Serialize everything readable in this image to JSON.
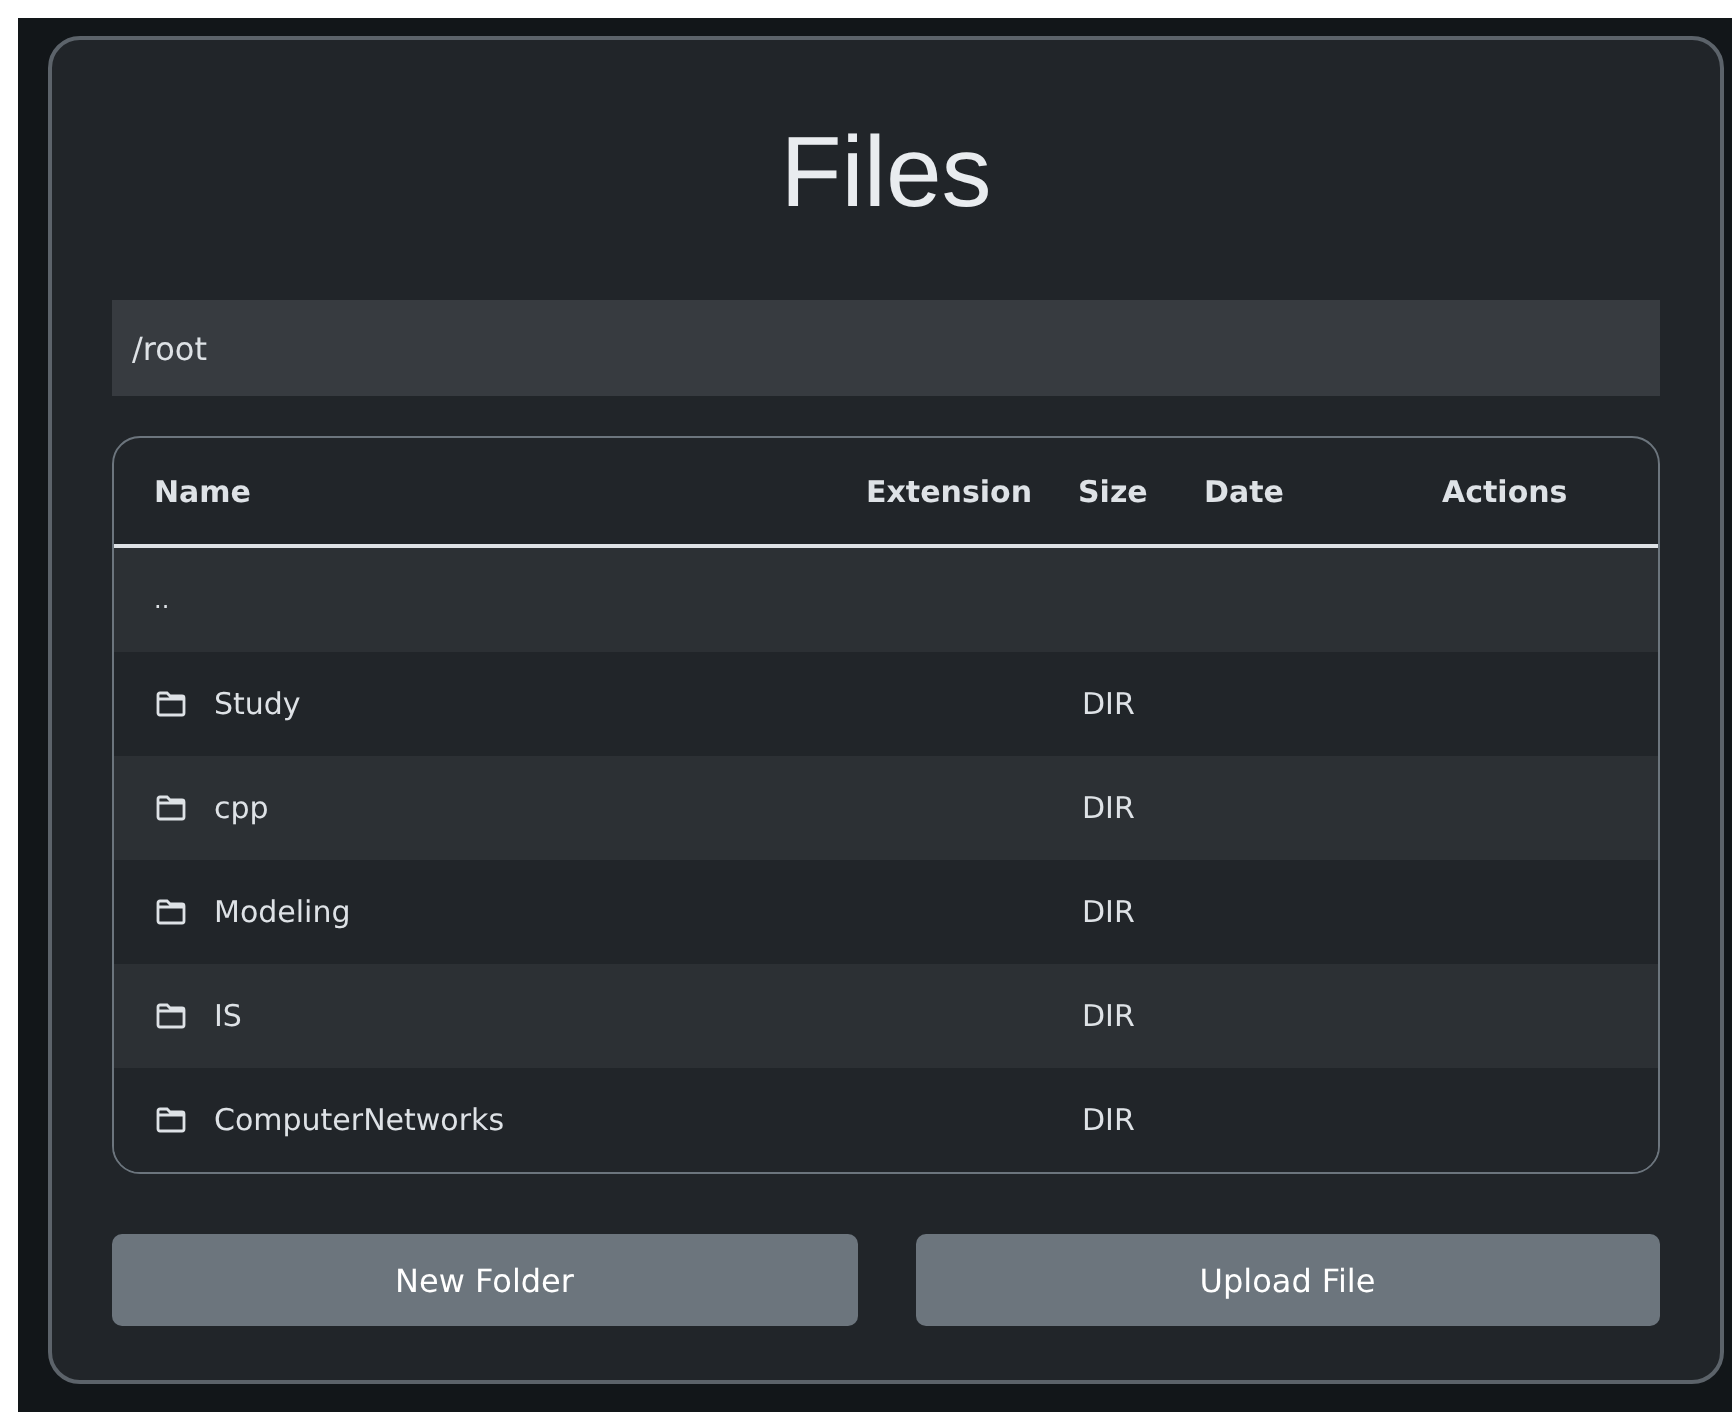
{
  "title": "Files",
  "path": {
    "value": "/root"
  },
  "table": {
    "columns": [
      "Name",
      "Extension",
      "Size",
      "Date",
      "Actions"
    ],
    "rows": [
      {
        "kind": "parent",
        "name": ".."
      },
      {
        "kind": "folder",
        "name": "Study",
        "size": "DIR"
      },
      {
        "kind": "folder",
        "name": "cpp",
        "size": "DIR"
      },
      {
        "kind": "folder",
        "name": "Modeling",
        "size": "DIR"
      },
      {
        "kind": "folder",
        "name": "IS",
        "size": "DIR"
      },
      {
        "kind": "folder",
        "name": "ComputerNetworks",
        "size": "DIR"
      }
    ]
  },
  "buttons": [
    "New Folder",
    "Upload File"
  ]
}
